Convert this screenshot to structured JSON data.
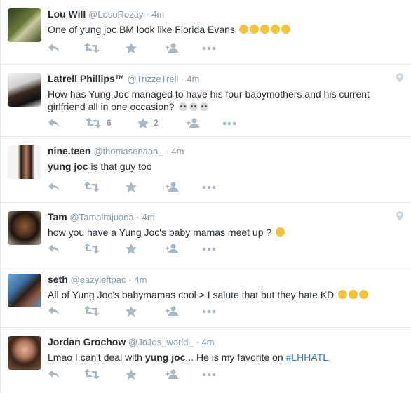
{
  "tweets": [
    {
      "name": "Lou Will",
      "handle": "@LosoRozay",
      "time": "4m",
      "text_parts": [
        {
          "t": "One of yung joc BM look like Florida Evans",
          "style": "plain"
        }
      ],
      "emoji": [
        "face-with-tears-of-joy",
        "face-with-tears-of-joy",
        "face-with-tears-of-joy",
        "face-with-tears-of-joy",
        "face-with-tears-of-joy"
      ],
      "retweets": "",
      "favorites": "",
      "geo": false
    },
    {
      "name": "Latrell Phillips™",
      "handle": "@TrizzeTrell",
      "time": "4m",
      "text_parts": [
        {
          "t": "How has Yung Joc managed to have his four babymothers and his current girlfriend all in one occasion?",
          "style": "plain"
        }
      ],
      "emoji": [
        "skull",
        "skull",
        "skull"
      ],
      "retweets": "6",
      "favorites": "2",
      "geo": true
    },
    {
      "name": "nine.teen ",
      "handle": "@thomasenaaa_",
      "time": "4m",
      "text_parts": [
        {
          "t": "yung joc",
          "style": "bold"
        },
        {
          "t": " is that guy too",
          "style": "plain"
        }
      ],
      "emoji": [],
      "retweets": "",
      "favorites": "",
      "geo": false
    },
    {
      "name": "Tam",
      "handle": "@Tamairajuana",
      "time": "4m",
      "text_parts": [
        {
          "t": "how you have a Yung Joc's baby mamas meet up ?",
          "style": "plain"
        }
      ],
      "emoji": [
        "face-with-tears-of-joy"
      ],
      "retweets": "",
      "favorites": "",
      "geo": true
    },
    {
      "name": "seth",
      "handle": "@eazyleftpac",
      "time": "4m",
      "text_parts": [
        {
          "t": "All of Yung Joc's babymamas cool > I salute that but they hate KD",
          "style": "plain"
        }
      ],
      "emoji": [
        "face-with-tears-of-joy",
        "face-with-tears-of-joy",
        "face-with-tears-of-joy"
      ],
      "retweets": "",
      "favorites": "",
      "geo": false
    },
    {
      "name": "Jordan Grochow",
      "handle": "@JoJos_world_",
      "time": "4m",
      "text_parts": [
        {
          "t": "Lmao I can't deal with ",
          "style": "plain"
        },
        {
          "t": "yung joc",
          "style": "bold"
        },
        {
          "t": "... He is my favorite on ",
          "style": "plain"
        },
        {
          "t": "#LHHATL",
          "style": "hashtag"
        }
      ],
      "emoji": [],
      "retweets": "",
      "favorites": "",
      "geo": false
    }
  ],
  "colors": {
    "name": "#292f33",
    "meta": "#8899a6",
    "icon": "#aab8c2",
    "hashtag": "#2b7bb9",
    "divider": "#e1e8ed"
  }
}
